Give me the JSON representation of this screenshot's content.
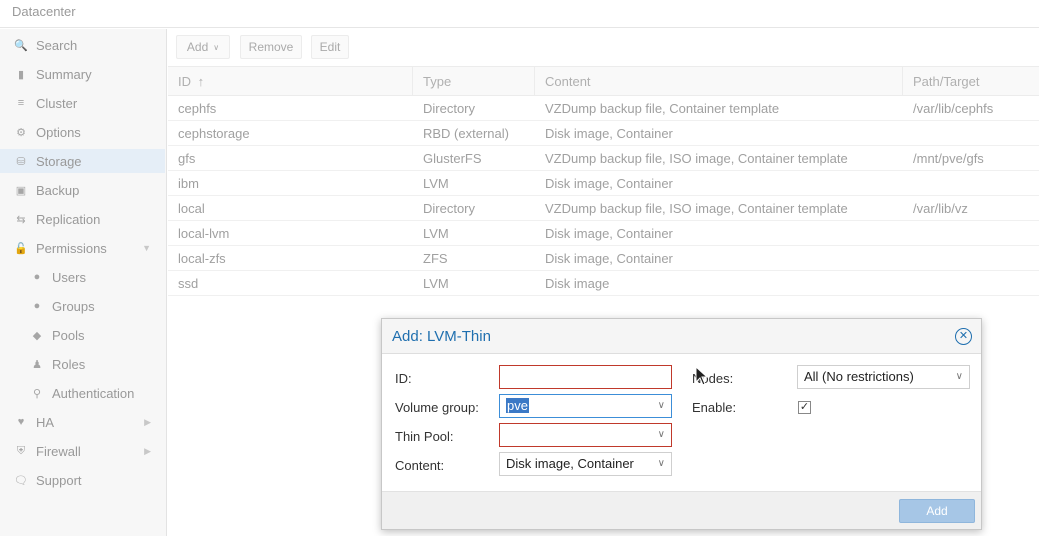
{
  "topbar": {
    "title": "Datacenter"
  },
  "sidebar": {
    "items": [
      {
        "label": "Search",
        "icon": "search-icon"
      },
      {
        "label": "Summary",
        "icon": "book-icon"
      },
      {
        "label": "Cluster",
        "icon": "server-icon"
      },
      {
        "label": "Options",
        "icon": "gear-icon"
      },
      {
        "label": "Storage",
        "icon": "database-icon"
      },
      {
        "label": "Backup",
        "icon": "floppy-icon"
      },
      {
        "label": "Replication",
        "icon": "retweet-icon"
      },
      {
        "label": "Permissions",
        "icon": "unlock-icon"
      },
      {
        "label": "Users",
        "icon": "user-icon"
      },
      {
        "label": "Groups",
        "icon": "users-icon"
      },
      {
        "label": "Pools",
        "icon": "tags-icon"
      },
      {
        "label": "Roles",
        "icon": "male-icon"
      },
      {
        "label": "Authentication",
        "icon": "key-icon"
      },
      {
        "label": "HA",
        "icon": "heartbeat-icon"
      },
      {
        "label": "Firewall",
        "icon": "shield-icon"
      },
      {
        "label": "Support",
        "icon": "comments-icon"
      }
    ]
  },
  "toolbar": {
    "add_label": "Add",
    "remove_label": "Remove",
    "edit_label": "Edit"
  },
  "grid": {
    "columns": [
      "ID",
      "Type",
      "Content",
      "Path/Target"
    ],
    "rows": [
      [
        "cephfs",
        "Directory",
        "VZDump backup file, Container template",
        "/var/lib/cephfs"
      ],
      [
        "cephstorage",
        "RBD (external)",
        "Disk image, Container",
        ""
      ],
      [
        "gfs",
        "GlusterFS",
        "VZDump backup file, ISO image, Container template",
        "/mnt/pve/gfs"
      ],
      [
        "ibm",
        "LVM",
        "Disk image, Container",
        ""
      ],
      [
        "local",
        "Directory",
        "VZDump backup file, ISO image, Container template",
        "/var/lib/vz"
      ],
      [
        "local-lvm",
        "LVM",
        "Disk image, Container",
        ""
      ],
      [
        "local-zfs",
        "ZFS",
        "Disk image, Container",
        ""
      ],
      [
        "ssd",
        "LVM",
        "Disk image",
        ""
      ]
    ]
  },
  "dialog": {
    "title": "Add: LVM-Thin",
    "id_label": "ID:",
    "id_value": "",
    "vg_label": "Volume group:",
    "vg_value": "pve",
    "thinpool_label": "Thin Pool:",
    "thinpool_value": "",
    "content_label": "Content:",
    "content_value": "Disk image, Container",
    "nodes_label": "Nodes:",
    "nodes_value": "All (No restrictions)",
    "enable_label": "Enable:",
    "enable_checked": true,
    "add_button": "Add"
  },
  "colors": {
    "accent": "#1f6faf",
    "invalid": "#c0392b",
    "add_button": "#a6c6e6"
  }
}
